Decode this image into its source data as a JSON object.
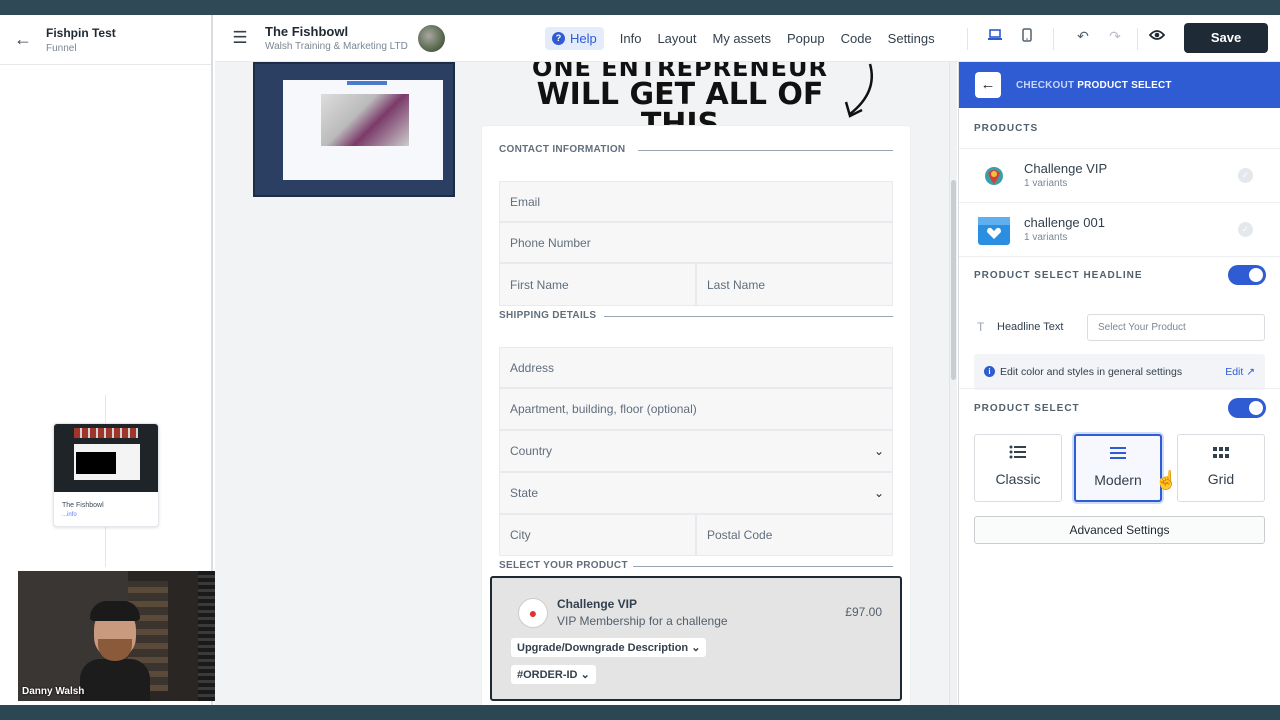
{
  "left_panel": {
    "back_icon": "arrow-left-icon",
    "funnel_name": "Fishpin Test",
    "funnel_type": "Funnel",
    "page_card_name": "The Fishbowl",
    "page_card_stat": "...info"
  },
  "webcam": {
    "person_name": "Danny Walsh"
  },
  "topbar": {
    "menu_icon": "hamburger-icon",
    "site_title": "The Fishbowl",
    "site_subtitle": "Walsh Training & Marketing LTD",
    "help_label": "Help",
    "menu_items": [
      "Info",
      "Layout",
      "My assets",
      "Popup",
      "Code",
      "Settings"
    ],
    "save_label": "Save",
    "icons": [
      "desktop-icon",
      "mobile-icon",
      "undo-icon",
      "redo-icon",
      "preview-eye-icon"
    ]
  },
  "canvas": {
    "headline_line1": "ONE ENTREPRENEUR",
    "headline_line2": "WILL GET ALL OF THIS",
    "contact_section": "CONTACT INFORMATION",
    "email_placeholder": "Email",
    "phone_placeholder": "Phone Number",
    "first_name_placeholder": "First Name",
    "last_name_placeholder": "Last Name",
    "shipping_section": "SHIPPING DETAILS",
    "address_placeholder": "Address",
    "apartment_placeholder": "Apartment, building, floor (optional)",
    "country_placeholder": "Country",
    "state_placeholder": "State",
    "city_placeholder": "City",
    "postal_placeholder": "Postal Code",
    "product_section": "SELECT YOUR PRODUCT",
    "product": {
      "name": "Challenge VIP",
      "description": "VIP Membership for a challenge",
      "price": "£97.00",
      "pill_upgrade": "Upgrade/Downgrade Description",
      "pill_order": "#ORDER-ID"
    }
  },
  "right_panel": {
    "breadcrumb_parent": "CHECKOUT",
    "breadcrumb_current": "PRODUCT SELECT",
    "products_section": "PRODUCTS",
    "products": [
      {
        "name": "Challenge VIP",
        "variants": "1 variants"
      },
      {
        "name": "challenge 001",
        "variants": "1 variants"
      }
    ],
    "headline_section": "PRODUCT SELECT HEADLINE",
    "headline_toggle_on": true,
    "headline_label": "Headline Text",
    "headline_placeholder": "Select Your Product",
    "info_text": "Edit color and styles in general settings",
    "info_link": "Edit ↗",
    "product_select_section": "PRODUCT SELECT",
    "product_select_toggle_on": true,
    "styles": [
      {
        "label": "Classic",
        "icon": "list-icon",
        "active": false
      },
      {
        "label": "Modern",
        "icon": "menu-lines-icon",
        "active": true
      },
      {
        "label": "Grid",
        "icon": "grid-icon",
        "active": false
      }
    ],
    "advanced_label": "Advanced Settings"
  },
  "colors": {
    "accent": "#2f5bd3",
    "save_bg": "#1e2a36",
    "panel_header": "#2f5bd3"
  }
}
